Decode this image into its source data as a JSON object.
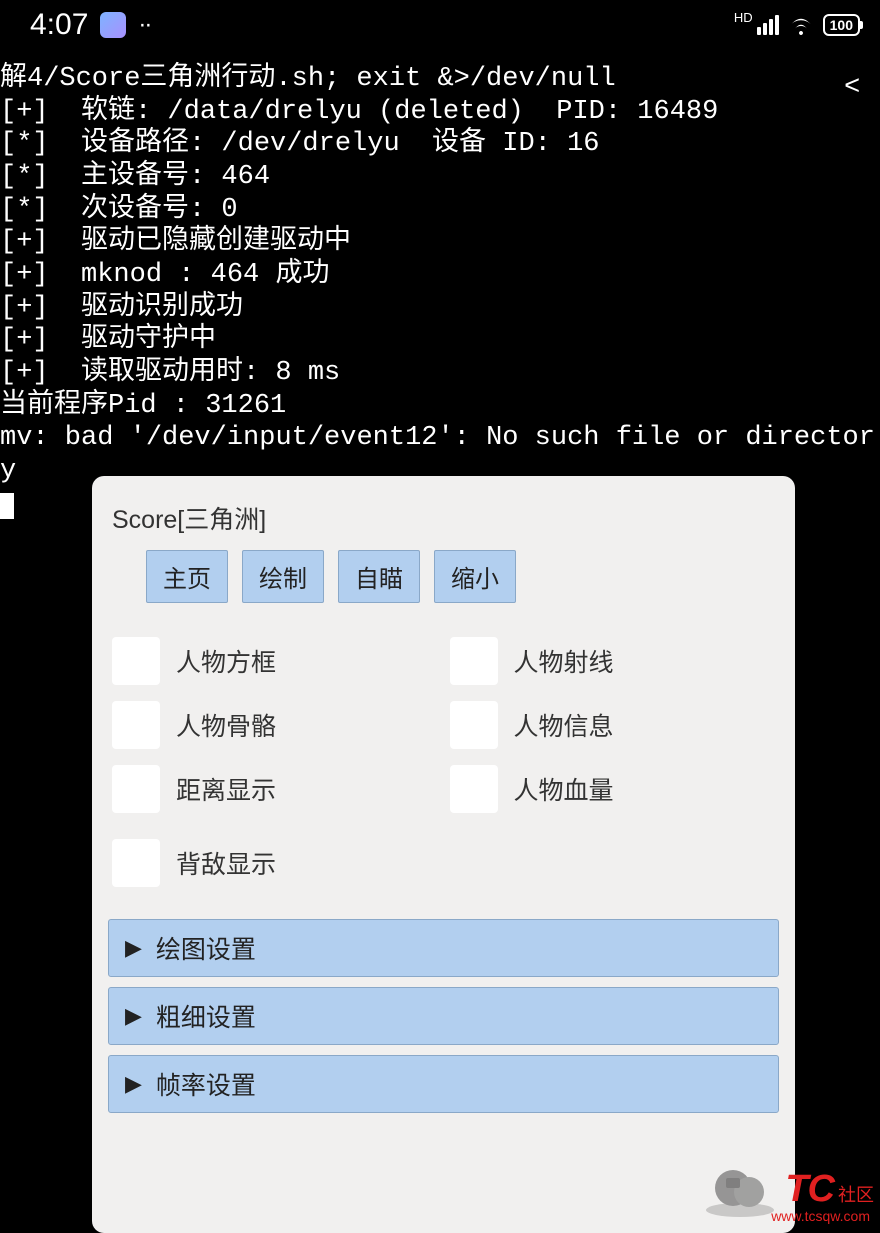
{
  "status": {
    "time": "4:07",
    "battery": "100"
  },
  "terminal": {
    "lines": [
      "解4/Score三角洲行动.sh; exit &>/dev/null",
      "[+]  软链: /data/drelyu (deleted)  PID: 16489",
      "[*]  设备路径: /dev/drelyu  设备 ID: 16",
      "[*]  主设备号: 464",
      "[*]  次设备号: 0",
      "[+]  驱动已隐藏创建驱动中",
      "[+]  mknod : 464 成功",
      "[+]  驱动识别成功",
      "[+]  驱动守护中",
      "[+]  读取驱动用时: 8 ms",
      "当前程序Pid : 31261",
      "mv: bad '/dev/input/event12': No such file or directory"
    ]
  },
  "overlay": {
    "title": "Score[三角洲]",
    "tabs": [
      "主页",
      "绘制",
      "自瞄",
      "缩小"
    ],
    "checkboxes": [
      {
        "label": "人物方框",
        "checked": false
      },
      {
        "label": "人物射线",
        "checked": false
      },
      {
        "label": "人物骨骼",
        "checked": false
      },
      {
        "label": "人物信息",
        "checked": false
      },
      {
        "label": "距离显示",
        "checked": false
      },
      {
        "label": "人物血量",
        "checked": false
      },
      {
        "label": "背敌显示",
        "checked": false
      }
    ],
    "accordions": [
      "绘图设置",
      "粗细设置",
      "帧率设置"
    ]
  },
  "watermark": {
    "brand": "TC",
    "sub": "社区",
    "url": "www.tcsqw.com"
  }
}
